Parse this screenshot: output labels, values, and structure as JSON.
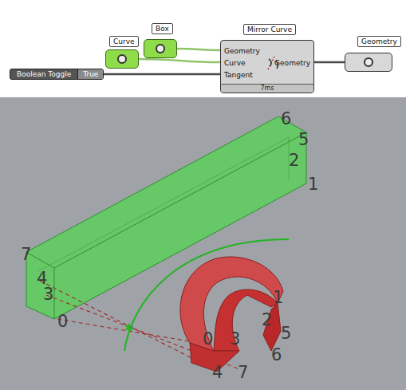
{
  "canvas": {
    "toggle": {
      "label": "Boolean Toggle",
      "value": "True",
      "on": true
    },
    "params": [
      {
        "label": "Curve",
        "selected": true
      },
      {
        "label": "Box",
        "selected": true
      }
    ],
    "component": {
      "title": "Mirror Curve",
      "inputs": [
        "Geometry",
        "Curve",
        "Tangent"
      ],
      "output": "Geometry",
      "time": "7ms"
    },
    "output_param": {
      "label": "Geometry",
      "selected": false
    }
  },
  "viewport": {
    "box_labels": [
      "0",
      "1",
      "2",
      "3",
      "4",
      "5",
      "6",
      "7"
    ],
    "mirror_labels": [
      "0",
      "1",
      "2",
      "3",
      "4",
      "5",
      "6",
      "7"
    ]
  }
}
